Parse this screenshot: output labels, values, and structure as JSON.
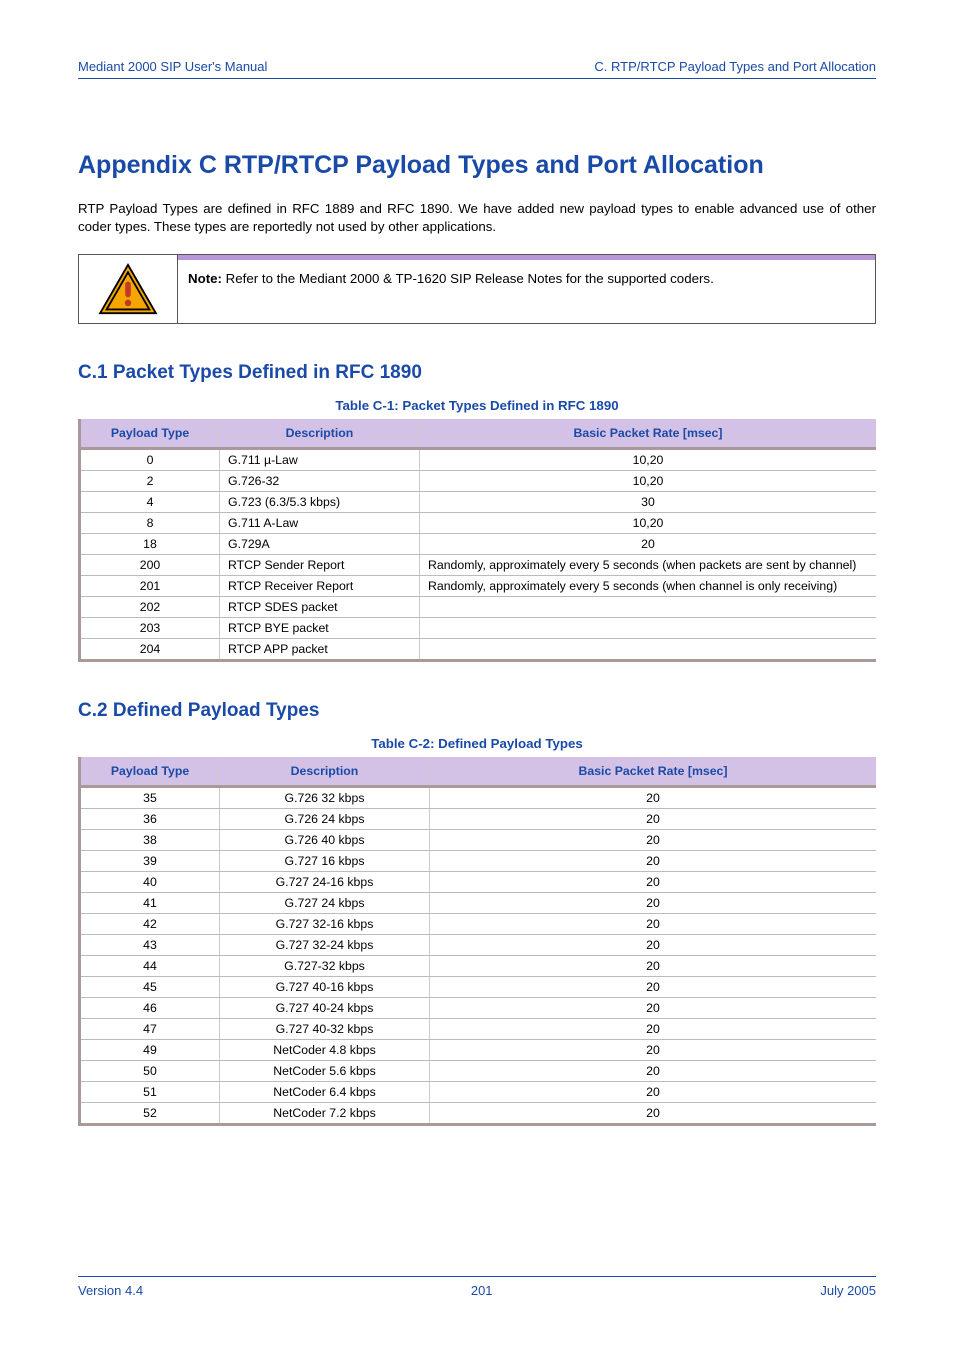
{
  "header": {
    "left": "Mediant 2000 SIP User's Manual",
    "right": "C. RTP/RTCP Payload Types and Port Allocation"
  },
  "appendix_title": "Appendix C RTP/RTCP Payload Types and Port Allocation",
  "intro": "RTP Payload Types are defined in RFC 1889 and RFC 1890. We have added new payload types to enable advanced use of other coder types. These types are reportedly not used by other applications.",
  "note": {
    "label": "Note:",
    "text": " Refer to the Mediant 2000 & TP-1620 SIP Release Notes for the supported coders."
  },
  "sectionC1": {
    "heading": "C.1 Packet Types Defined in RFC 1890",
    "caption": "Table  C-1: Packet Types Defined in RFC 1890",
    "cols": [
      "Payload Type",
      "Description",
      "Basic Packet Rate [msec]"
    ],
    "rows": [
      [
        "0",
        "G.711 µ-Law",
        "10,20"
      ],
      [
        "2",
        "G.726-32",
        "10,20"
      ],
      [
        "4",
        "G.723 (6.3/5.3 kbps)",
        "30"
      ],
      [
        "8",
        "G.711 A-Law",
        "10,20"
      ],
      [
        "18",
        "G.729A",
        "20"
      ],
      [
        "200",
        "RTCP Sender Report",
        "Randomly, approximately every 5 seconds (when packets are sent by channel)"
      ],
      [
        "201",
        "RTCP Receiver Report",
        "Randomly, approximately every 5 seconds (when channel is only receiving)"
      ],
      [
        "202",
        "RTCP SDES packet",
        ""
      ],
      [
        "203",
        "RTCP BYE packet",
        ""
      ],
      [
        "204",
        "RTCP APP packet",
        ""
      ]
    ]
  },
  "sectionC2": {
    "heading": "C.2 Defined Payload Types",
    "caption": "Table  C-2: Defined Payload Types",
    "cols": [
      "Payload Type",
      "Description",
      "Basic Packet Rate [msec]"
    ],
    "rows": [
      [
        "35",
        "G.726 32 kbps",
        "20"
      ],
      [
        "36",
        "G.726 24 kbps",
        "20"
      ],
      [
        "38",
        "G.726 40 kbps",
        "20"
      ],
      [
        "39",
        "G.727 16 kbps",
        "20"
      ],
      [
        "40",
        "G.727 24-16 kbps",
        "20"
      ],
      [
        "41",
        "G.727 24 kbps",
        "20"
      ],
      [
        "42",
        "G.727 32-16 kbps",
        "20"
      ],
      [
        "43",
        "G.727 32-24 kbps",
        "20"
      ],
      [
        "44",
        "G.727-32 kbps",
        "20"
      ],
      [
        "45",
        "G.727 40-16 kbps",
        "20"
      ],
      [
        "46",
        "G.727 40-24 kbps",
        "20"
      ],
      [
        "47",
        "G.727 40-32 kbps",
        "20"
      ],
      [
        "49",
        "NetCoder 4.8 kbps",
        "20"
      ],
      [
        "50",
        "NetCoder 5.6 kbps",
        "20"
      ],
      [
        "51",
        "NetCoder 6.4 kbps",
        "20"
      ],
      [
        "52",
        "NetCoder 7.2 kbps",
        "20"
      ]
    ]
  },
  "footer": {
    "left": "Version 4.4",
    "center": "201",
    "right": "July 2005"
  }
}
